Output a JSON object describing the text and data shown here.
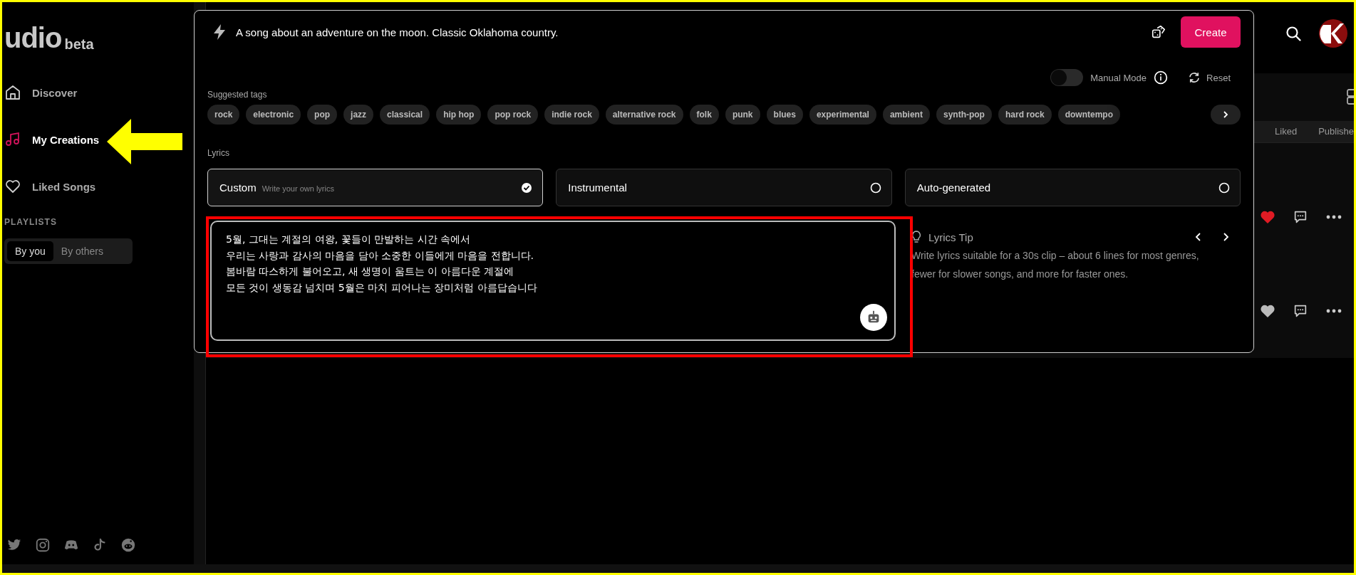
{
  "sidebar": {
    "logo": "udio",
    "logo_tag": "beta",
    "nav": [
      {
        "label": "Discover",
        "selected": false
      },
      {
        "label": "My Creations",
        "selected": true
      },
      {
        "label": "Liked Songs",
        "selected": false
      }
    ],
    "playlists_heading": "PLAYLISTS",
    "playlist_tabs": [
      {
        "label": "By you",
        "selected": true
      },
      {
        "label": "By others",
        "selected": false
      }
    ]
  },
  "creator": {
    "prompt": "A song about an adventure on the moon. Classic Oklahoma country.",
    "create_button": "Create",
    "manual_mode": {
      "label": "Manual Mode",
      "on": false
    },
    "reset_button": "Reset",
    "tags_heading": "Suggested tags",
    "tags": [
      "rock",
      "electronic",
      "pop",
      "jazz",
      "classical",
      "hip hop",
      "pop rock",
      "indie rock",
      "alternative rock",
      "folk",
      "punk",
      "blues",
      "experimental",
      "ambient",
      "synth-pop",
      "hard rock",
      "downtempo"
    ],
    "lyrics_heading": "Lyrics",
    "lyrics_options": [
      {
        "label": "Custom",
        "hint": "Write your own lyrics",
        "selected": true
      },
      {
        "label": "Instrumental",
        "selected": false
      },
      {
        "label": "Auto-generated",
        "selected": false
      }
    ],
    "lyrics": "5월, 그대는 계절의 여왕, 꽃들이 만발하는 시간 속에서\n우리는 사랑과 감사의 마음을 담아 소중한 이들에게 마음을 전합니다.\n봄바람 따스하게 불어오고, 새 생명이 움트는 이 아름다운 계절에\n모든 것이 생동감 넘치며 5월은 마치 피어나는 장미처럼 아름답습니다",
    "tip": {
      "title": "Lyrics Tip",
      "text": "Write lyrics suitable for a 30s clip – about 6 lines for most genres, fewer for slower songs, and more for faster ones."
    }
  },
  "library": {
    "tabs": [
      {
        "label": "Liked"
      },
      {
        "label": "Publishe"
      }
    ],
    "songs": [
      {
        "liked": true
      },
      {
        "liked": false
      }
    ]
  }
}
